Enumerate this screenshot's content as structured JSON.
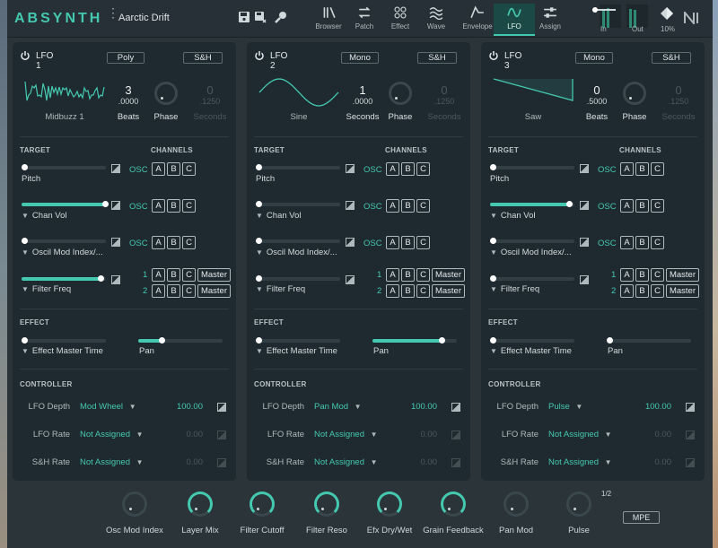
{
  "app": {
    "name": "ABSYNTH",
    "preset": "Aarctic Drift"
  },
  "nav": [
    {
      "label": "Browser",
      "icon": "browser-icon"
    },
    {
      "label": "Patch",
      "icon": "patch-icon"
    },
    {
      "label": "Effect",
      "icon": "effect-icon"
    },
    {
      "label": "Wave",
      "icon": "wave-icon"
    },
    {
      "label": "Envelope",
      "icon": "envelope-icon"
    },
    {
      "label": "LFO",
      "icon": "lfo-icon",
      "active": true
    },
    {
      "label": "Assign",
      "icon": "assign-icon"
    }
  ],
  "meters": {
    "in_label": "In",
    "out_label": "Out",
    "volume": "10%"
  },
  "colors": {
    "accent": "#45c8b0",
    "panel": "#1f2a30",
    "background": "#2a3439"
  },
  "lfos": [
    {
      "title": "LFO 1",
      "mode": "Poly",
      "sh": "S&H",
      "wave": "Midbuzz 1",
      "rate": "3",
      "rate_sub": ".0000",
      "rate_unit": "Beats",
      "phase": "Phase",
      "seconds": "0",
      "seconds_sub": ".1250",
      "seconds_unit": "Seconds",
      "target_label": "TARGET",
      "channels_label": "CHANNELS",
      "targets": [
        {
          "label": "Pitch",
          "caret": false,
          "level": 0.0,
          "osc": "OSC"
        },
        {
          "label": "Chan  Vol",
          "caret": true,
          "level": 1.0,
          "osc": "OSC"
        },
        {
          "label": "Oscil  Mod Index/...",
          "caret": true,
          "level": 0.0,
          "osc": "OSC"
        },
        {
          "label": "Filter  Freq",
          "caret": true,
          "level": 0.95
        }
      ],
      "filter_rows": [
        "1",
        "2"
      ],
      "buttons": [
        "A",
        "B",
        "C"
      ],
      "master": "Master",
      "effect_label": "EFFECT",
      "effect_target": "Effect Master Time",
      "effect_level": 0.0,
      "pan_label": "Pan",
      "pan_level": 0.28,
      "controller_label": "CONTROLLER",
      "controllers": [
        {
          "label": "LFO Depth",
          "value": "Mod Wheel",
          "amount": "100.00",
          "active": true
        },
        {
          "label": "LFO Rate",
          "value": "Not Assigned",
          "amount": "0.00",
          "active": false
        },
        {
          "label": "S&H Rate",
          "value": "Not Assigned",
          "amount": "0.00",
          "active": false
        }
      ]
    },
    {
      "title": "LFO 2",
      "mode": "Mono",
      "sh": "S&H",
      "wave": "Sine",
      "rate": "1",
      "rate_sub": ".0000",
      "rate_unit": "Seconds",
      "phase": "Phase",
      "seconds": "0",
      "seconds_sub": ".1250",
      "seconds_unit": "Seconds",
      "target_label": "TARGET",
      "channels_label": "CHANNELS",
      "targets": [
        {
          "label": "Pitch",
          "caret": false,
          "level": 0.0,
          "osc": "OSC"
        },
        {
          "label": "Chan  Vol",
          "caret": true,
          "level": 0.0,
          "osc": "OSC"
        },
        {
          "label": "Oscil  Mod Index/...",
          "caret": true,
          "level": 0.0,
          "osc": "OSC"
        },
        {
          "label": "Filter  Freq",
          "caret": true,
          "level": 0.0
        }
      ],
      "filter_rows": [
        "1",
        "2"
      ],
      "buttons": [
        "A",
        "B",
        "C"
      ],
      "master": "Master",
      "effect_label": "EFFECT",
      "effect_target": "Effect Master Time",
      "effect_level": 0.0,
      "pan_label": "Pan",
      "pan_level": 0.82,
      "controller_label": "CONTROLLER",
      "controllers": [
        {
          "label": "LFO Depth",
          "value": "Pan Mod",
          "amount": "100.00",
          "active": true
        },
        {
          "label": "LFO Rate",
          "value": "Not Assigned",
          "amount": "0.00",
          "active": false
        },
        {
          "label": "S&H Rate",
          "value": "Not Assigned",
          "amount": "0.00",
          "active": false
        }
      ]
    },
    {
      "title": "LFO 3",
      "mode": "Mono",
      "sh": "S&H",
      "wave": "Saw",
      "rate": "0",
      "rate_sub": ".5000",
      "rate_unit": "Beats",
      "phase": "Phase",
      "seconds": "0",
      "seconds_sub": ".1250",
      "seconds_unit": "Seconds",
      "target_label": "TARGET",
      "channels_label": "CHANNELS",
      "targets": [
        {
          "label": "Pitch",
          "caret": false,
          "level": 0.0,
          "osc": "OSC"
        },
        {
          "label": "Chan  Vol",
          "caret": true,
          "level": 0.95,
          "osc": "OSC"
        },
        {
          "label": "Oscil  Mod Index/...",
          "caret": true,
          "level": 0.0,
          "osc": "OSC"
        },
        {
          "label": "Filter  Freq",
          "caret": true,
          "level": 0.0
        }
      ],
      "filter_rows": [
        "1",
        "2"
      ],
      "buttons": [
        "A",
        "B",
        "C"
      ],
      "master": "Master",
      "effect_label": "EFFECT",
      "effect_target": "Effect Master Time",
      "effect_level": 0.0,
      "pan_label": "Pan",
      "pan_level": 0.0,
      "controller_label": "CONTROLLER",
      "controllers": [
        {
          "label": "LFO Depth",
          "value": "Pulse",
          "amount": "100.00",
          "active": true
        },
        {
          "label": "LFO Rate",
          "value": "Not Assigned",
          "amount": "0.00",
          "active": false
        },
        {
          "label": "S&H Rate",
          "value": "Not Assigned",
          "amount": "0.00",
          "active": false
        }
      ]
    }
  ],
  "macros": [
    {
      "label": "Osc Mod Index",
      "active": false
    },
    {
      "label": "Layer Mix",
      "active": true
    },
    {
      "label": "Filter Cutoff",
      "active": true
    },
    {
      "label": "Filter Reso",
      "active": true
    },
    {
      "label": "Efx Dry/Wet",
      "active": true
    },
    {
      "label": "Grain Feedback",
      "active": true
    },
    {
      "label": "Pan Mod",
      "active": false
    },
    {
      "label": "Pulse",
      "active": false
    }
  ],
  "macro_page": "1/2",
  "mpe": "MPE"
}
